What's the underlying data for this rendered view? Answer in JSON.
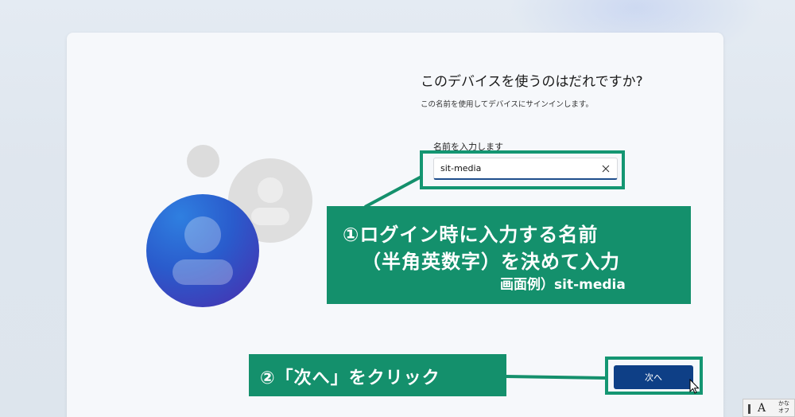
{
  "setup": {
    "title": "このデバイスを使うのはだれですか?",
    "subtitle": "この名前を使用してデバイスにサインインします。",
    "field_label": "名前を入力します",
    "field_value": "sit-media",
    "next_label": "次へ"
  },
  "annotations": {
    "callout1_line1": "①ログイン時に入力する名前",
    "callout1_line2": "（半角英数字）を決めて入力",
    "callout1_line3": "画面例）sit-media",
    "callout2_text": "②「次へ」をクリック"
  },
  "ime": {
    "mode_label": "A",
    "kana_label_top": "かな",
    "kana_label_bottom": "オフ"
  },
  "colors": {
    "accent_green": "#14906c",
    "button_blue": "#0e3f86",
    "input_underline": "#1f4e8c"
  }
}
